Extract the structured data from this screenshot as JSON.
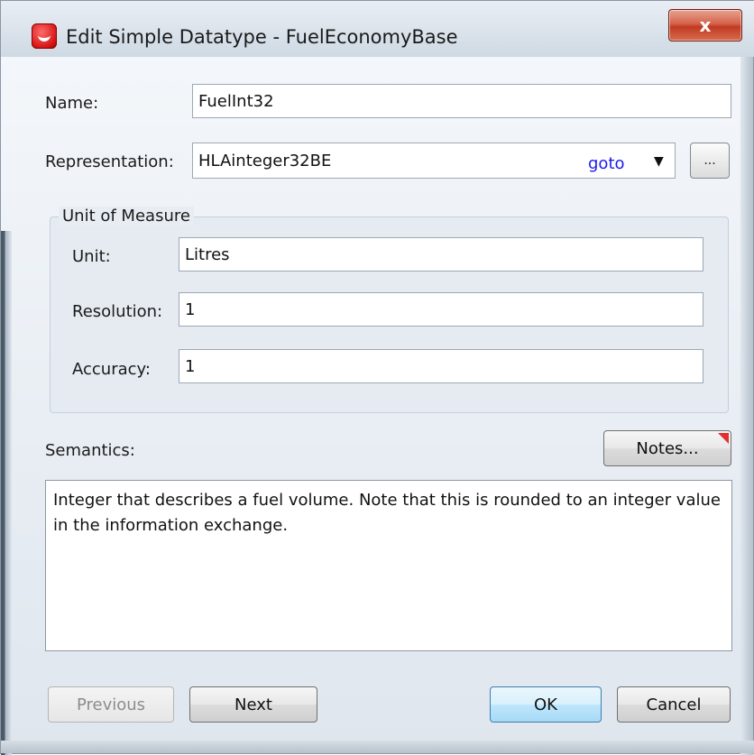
{
  "window": {
    "title": "Edit Simple Datatype - FuelEconomyBase",
    "close_label": "x"
  },
  "name": {
    "label": "Name:",
    "value": "FuelInt32"
  },
  "representation": {
    "label": "Representation:",
    "value": "HLAinteger32BE",
    "goto_label": "goto",
    "dropdown_glyph": "▼",
    "browse_label": "..."
  },
  "unit_of_measure": {
    "title": "Unit of Measure",
    "unit_label": "Unit:",
    "unit_value": "Litres",
    "resolution_label": "Resolution:",
    "resolution_value": "1",
    "accuracy_label": "Accuracy:",
    "accuracy_value": "1"
  },
  "semantics": {
    "label": "Semantics:",
    "notes_label": "Notes...",
    "text": "Integer that describes a fuel volume. Note that this is rounded to an integer value in the information exchange."
  },
  "buttons": {
    "previous": "Previous",
    "next": "Next",
    "ok": "OK",
    "cancel": "Cancel"
  },
  "colors": {
    "goto_link": "#1a1af0",
    "close_button": "#c13b22",
    "notes_flag": "#e03030",
    "ok_button": "#bee6fd"
  },
  "icons": {
    "app": "red-app-icon",
    "close": "close-icon",
    "dropdown": "chevron-down-icon",
    "notes_flag": "red-corner-flag-icon"
  }
}
